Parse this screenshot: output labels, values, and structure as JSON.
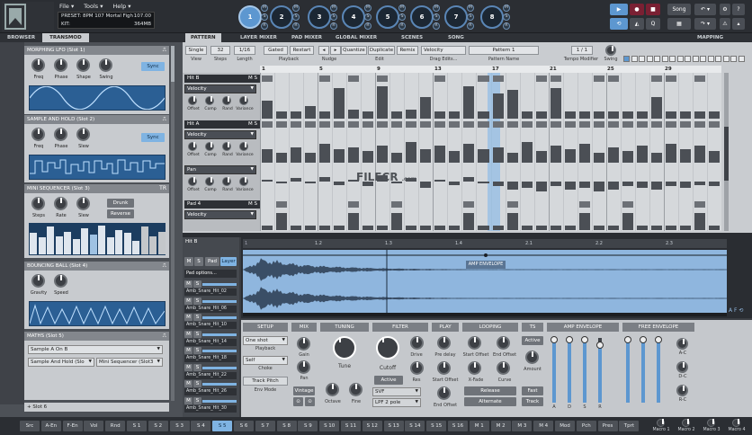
{
  "menu": [
    "File ▾",
    "Tools ▾",
    "Help ▾"
  ],
  "info": {
    "preset_label": "PRESET:",
    "preset": "8PM 107 Mortal Figh",
    "bpm": "107.00",
    "kit_label": "KIT:",
    "mem": "364MB"
  },
  "pads": [
    "1",
    "2",
    "3",
    "4",
    "5",
    "6",
    "7",
    "8"
  ],
  "transport": {
    "song": "Song"
  },
  "left_tabs": [
    "BROWSER",
    "TRANSMOD"
  ],
  "modules": {
    "lfo": {
      "title": "MORPHING LFO (Slot 1)",
      "knobs": [
        "Freq",
        "Phase",
        "Shape",
        "Swing"
      ],
      "sync": "Sync"
    },
    "sh": {
      "title": "SAMPLE AND HOLD (Slot 2)",
      "knobs": [
        "Freq",
        "Phase",
        "Slew"
      ],
      "sync": "Sync"
    },
    "seq": {
      "title": "MINI SEQUENCER (Slot 3)",
      "knobs": [
        "Steps",
        "Rate",
        "Slew"
      ],
      "b1": "Drunk",
      "b2": "Reverse",
      "tr": "TR"
    },
    "ball": {
      "title": "BOUNCING BALL (Slot 4)",
      "knobs": [
        "Gravity",
        "Speed"
      ]
    },
    "maths": {
      "title": "MATHS (Slot 5)",
      "s1": "Sample A On B",
      "s2": "Sample And Hold (Slo",
      "s3": "Mini Sequencer (Slot3",
      "slot6": "Slot 6"
    }
  },
  "main_tabs": [
    "PATTERN",
    "LAYER MIXER",
    "PAD MIXER",
    "GLOBAL MIXER",
    "SCENES",
    "SONG",
    "MAPPING"
  ],
  "controls": {
    "single": "Single",
    "view": "View",
    "steps_val": "32",
    "steps": "Steps",
    "len_val": "1/16",
    "length": "Length",
    "gated": "Gated",
    "restart": "Restart",
    "playback": "Playback",
    "nudge": "Nudge",
    "quantize": "Quantize",
    "duplicate": "Duplicate",
    "remix": "Remix",
    "edit": "Edit",
    "velocity": "Velocity",
    "drag": "Drag Edits...",
    "pattern_name": "Pattern 1",
    "pattern_label": "Pattern Name",
    "page": "1 / 1",
    "tempo_mod": "Tempo Modifier",
    "swing": "Swing"
  },
  "beats": [
    "1",
    "5",
    "9",
    "13",
    "17",
    "21",
    "25",
    "29"
  ],
  "rows": {
    "hitb": "Hit B",
    "vel1": "Velocity",
    "hita": "Hit A",
    "vel2": "Velocity",
    "pan": "Pan",
    "pad4": "Pad 4",
    "vel3": "Velocity",
    "ms": "M",
    "ss": "S",
    "knobs": [
      "Offset",
      "Comp",
      "Rand",
      "Variance"
    ]
  },
  "left2": {
    "title": "Hit B",
    "pad_opts": "Pad options...",
    "samples": [
      "Amb_Snare_Hit_02",
      "Amb_Snare_Hit_06",
      "Amb_Snare_Hit_10",
      "Amb_Snare_Hit_14",
      "Amb_Snare_Hit_18",
      "Amb_Snare_Hit_22",
      "Amb_Snare_Hit_26",
      "Amb_Snare_Hit_30"
    ],
    "pad": "Pad",
    "layer": "Layer"
  },
  "editor": {
    "ticks": [
      "1.2",
      "1.3",
      "1.4",
      "2.1",
      "2.2",
      "2.3"
    ],
    "amp": "AMP ENVELOPE"
  },
  "lower": {
    "sections": [
      "SETUP",
      "MIX",
      "TUNING",
      "FILTER",
      "PLAY",
      "LOOPING",
      "TS",
      "AMP ENVELOPE",
      "FREE ENVELOPE"
    ],
    "oneshot": "One shot",
    "playback": "Playback",
    "self": "Self",
    "choke": "Choke",
    "trackpitch": "Track Pitch",
    "envmode": "Env Mode",
    "gain": "Gain",
    "pan": "Pan",
    "vintage": "Vintage",
    "tune": "Tune",
    "octave": "Octave",
    "fine": "Fine",
    "cutoff": "Cutoff",
    "drive": "Drive",
    "res": "Res",
    "active": "Active",
    "svf": "SVF",
    "lpf": "LPF 2 pole",
    "predelay": "Pre delay",
    "startoffset": "Start Offset",
    "endoffset": "End Offset",
    "ls_start": "Start Offset",
    "ls_end": "End Offset",
    "xfade": "X-Fade",
    "curve": "Curve",
    "release": "Release",
    "alternate": "Alternate",
    "ts_active": "Active",
    "amount": "Amount",
    "fast": "Fast",
    "track": "Track",
    "env_labels": [
      "A",
      "D",
      "S",
      "R"
    ],
    "fenv_labels": [
      "A-C",
      "D-C",
      "R-C"
    ]
  },
  "bottom": [
    "Src",
    "A-En",
    "F-En",
    "Vol",
    "Rnd",
    "S 1",
    "S 2",
    "S 3",
    "S 4",
    "S 5",
    "S 6",
    "S 7",
    "S 8",
    "S 9",
    "S 10",
    "S 11",
    "S 12",
    "S 13",
    "S 14",
    "S 15",
    "S 16",
    "M 1",
    "M 2",
    "M 3",
    "M 4",
    "Mod",
    "Pch",
    "Pres",
    "Tprt"
  ],
  "macros": [
    "Macro 1",
    "Macro 2",
    "Macro 3",
    "Macro 4"
  ],
  "watermark": "FILECR",
  "watermark_sub": ".com"
}
